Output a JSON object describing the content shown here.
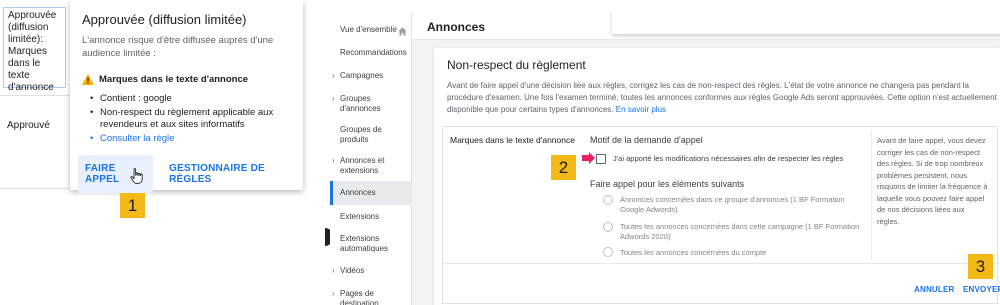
{
  "left": {
    "status_1": "Approuvée (diffusion limitée): Marques dans le texte d'annonce",
    "status_2": "Approuvé",
    "popup": {
      "title": "Approuvée (diffusion limitée)",
      "description": "L'annonce risque d'être diffusée auprès d'une audience limitée :",
      "warning": "Marques dans le texte d'annonce",
      "items": [
        "Contient : google",
        "Non-respect du règlement applicable aux revendeurs et aux sites informatifs"
      ],
      "link": "Consulter la règle",
      "appeal_button": "FAIRE APPEL",
      "rules_button": "GESTIONNAIRE DE RÈGLES"
    }
  },
  "callouts": [
    "1",
    "2",
    "3"
  ],
  "sidenav": {
    "items": [
      {
        "label": "Vue d'ensemble",
        "chevron": false
      },
      {
        "label": "Recommandations",
        "chevron": false
      },
      {
        "label": "Campagnes",
        "chevron": true
      },
      {
        "label": "Groupes d'annonces",
        "chevron": true
      },
      {
        "label": "Groupes de produits",
        "chevron": false
      },
      {
        "label": "Annonces et extensions",
        "chevron": true
      },
      {
        "label": "Annonces",
        "chevron": false
      },
      {
        "label": "Extensions",
        "chevron": false
      },
      {
        "label": "Extensions automatiques",
        "chevron": false
      },
      {
        "label": "Vidéos",
        "chevron": true
      },
      {
        "label": "Pages de destination",
        "chevron": true
      }
    ]
  },
  "header": {
    "title": "Annonces"
  },
  "card": {
    "title": "Non-respect du règlement",
    "description": "Avant de faire appel d'une décision liée aux règles, corrigez les cas de non-respect des règles. L'état de votre annonce ne changera pas pendant la procédure d'examen. Une fois l'examen terminé, toutes les annonces conformes aux règles Google Ads seront approuvées. Cette option n'est actuellement disponible que pour certains types d'annonces.",
    "learn_more": "En savoir plus",
    "policy_label": "Marques dans le texte d'annonce",
    "motif_title": "Motif de la demande d'appel",
    "checkbox_label": "J'ai apporté les modifications nécessaires afin de respecter les règles",
    "scope_title": "Faire appel pour les éléments suivants",
    "radios": [
      "Annonces concernées dans ce groupe d'annonces (1 BF Formation Google Adwords)",
      "Toutes les annonces concernées dans cette campagne (1 BF Formation Adwords 2020)",
      "Toutes les annonces concernées du compte"
    ],
    "side_help": "Avant de faire appel, vous devez corriger les cas de non-respect des règles. Si de trop nombreux problèmes persistent, nous risquons de limiter la fréquence à laquelle vous pouvez faire appel de nos décisions liées aux règles.",
    "cancel_button": "ANNULER",
    "submit_button": "ENVOYER"
  },
  "colors": {
    "accent": "#1a73e8",
    "callout": "#f3b917",
    "warning": "#f9ab00",
    "arrow": "#e91e63"
  }
}
